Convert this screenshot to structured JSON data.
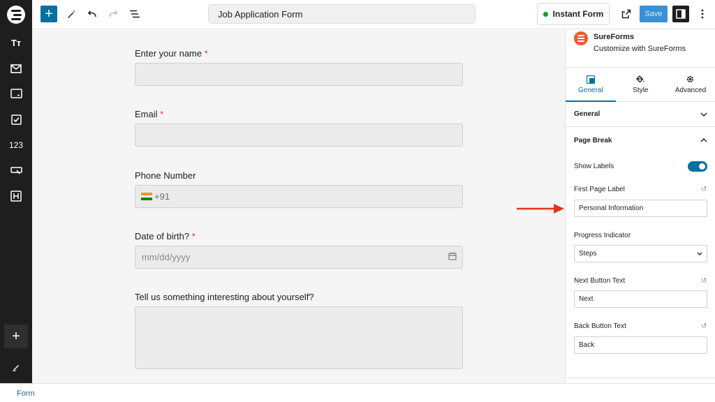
{
  "toolbar": {
    "document_title": "Job Application Form",
    "instant_form_label": "Instant Form",
    "save_label": "Save"
  },
  "sidebar_rail": {
    "items": [
      {
        "icon": "wordpress-logo-icon"
      },
      {
        "icon": "text-block-icon",
        "text": "Tт"
      },
      {
        "icon": "email-block-icon"
      },
      {
        "icon": "input-block-icon"
      },
      {
        "icon": "checkbox-block-icon"
      },
      {
        "icon": "number-block-icon",
        "text": "123"
      },
      {
        "icon": "button-block-icon"
      },
      {
        "icon": "heading-block-icon"
      },
      {
        "icon": "add-block-icon"
      },
      {
        "icon": "edit-icon"
      }
    ]
  },
  "form": {
    "fields": [
      {
        "label": "Enter your name",
        "required": "*"
      },
      {
        "label": "Email",
        "required": "*"
      },
      {
        "label": "Phone Number",
        "prefix": "+91"
      },
      {
        "label": "Date of birth?",
        "required": "*",
        "placeholder": "mm/dd/yyyy"
      },
      {
        "label": "Tell us something interesting about yourself?"
      }
    ]
  },
  "panel": {
    "plugin_name": "SureForms",
    "plugin_sub": "Customize with SureForms",
    "tabs": [
      {
        "label": "General",
        "icon": "general-tab-icon"
      },
      {
        "label": "Style",
        "icon": "paint-bucket-icon"
      },
      {
        "label": "Advanced",
        "icon": "gear-icon"
      }
    ],
    "sections": {
      "general": "General",
      "page_break": "Page Break"
    },
    "controls": {
      "show_labels": "Show Labels",
      "show_labels_on": true,
      "first_page_label": "First Page Label",
      "first_page_value": "Personal Information",
      "progress_indicator": "Progress Indicator",
      "progress_value": "Steps",
      "next_button_text": "Next Button Text",
      "next_button_value": "Next",
      "back_button_text": "Back Button Text",
      "back_button_value": "Back"
    }
  },
  "footer": {
    "breadcrumb": "Form"
  },
  "colors": {
    "accent": "#0071a1",
    "required": "#d63638",
    "annotation_arrow": "#e8321e",
    "sureforms_brand": "#eb5b2f"
  }
}
